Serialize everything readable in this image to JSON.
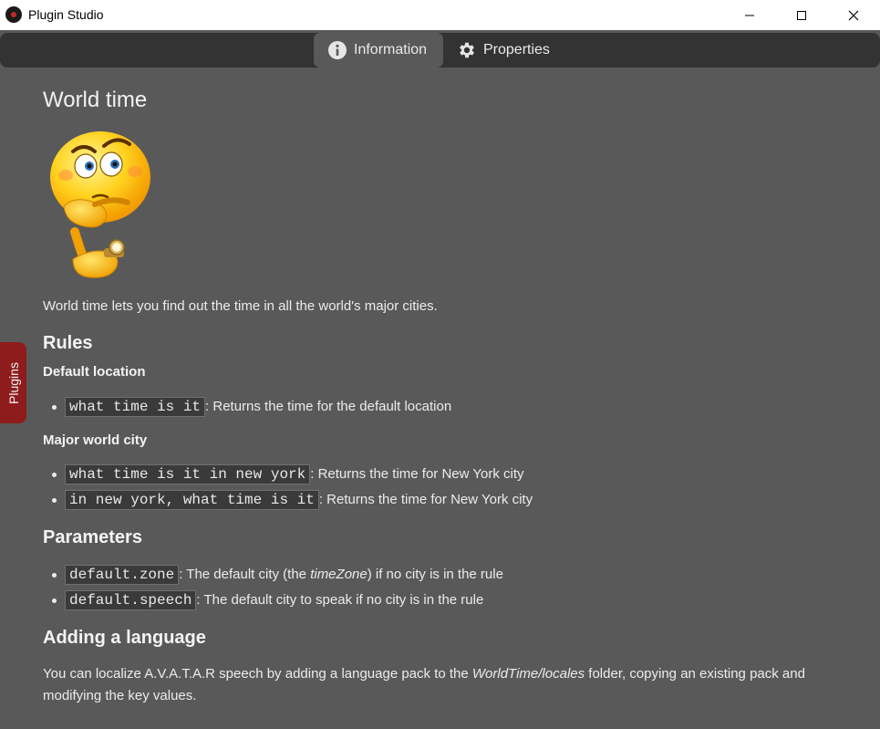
{
  "window": {
    "title": "Plugin Studio"
  },
  "tabs": {
    "information": {
      "label": "Information",
      "icon": "info-icon",
      "active": true
    },
    "properties": {
      "label": "Properties",
      "icon": "gear-icon",
      "active": false
    }
  },
  "side_tab": {
    "label": "Plugins"
  },
  "page": {
    "title": "World time",
    "image": "thinking-emoji-with-watch",
    "intro": "World time lets you find out the time in all the world's major cities.",
    "rules_heading": "Rules",
    "default_location": {
      "heading": "Default location",
      "items": [
        {
          "code": "what time is it",
          "desc": ": Returns the time for the default location"
        }
      ]
    },
    "major_city": {
      "heading": "Major world city",
      "items": [
        {
          "code": "what time is it in new york",
          "desc": ": Returns the time for New York city"
        },
        {
          "code": "in new york, what time is it",
          "desc": ": Returns the time for New York city"
        }
      ]
    },
    "parameters": {
      "heading": "Parameters",
      "items": [
        {
          "code": "default.zone",
          "desc_pre": ": The default city (the ",
          "desc_em": "timeZone",
          "desc_post": ") if no city is in the rule"
        },
        {
          "code": "default.speech",
          "desc_pre": ": The default city to speak if no city is in the rule",
          "desc_em": "",
          "desc_post": ""
        }
      ]
    },
    "language": {
      "heading": "Adding a language",
      "text_pre": "You can localize A.V.A.T.A.R speech by adding a language pack to the ",
      "text_em": "WorldTime/locales",
      "text_post": " folder, copying an existing pack and modifying the key values."
    }
  },
  "colors": {
    "background": "#595959",
    "tabbar": "#333333",
    "active_tab": "#595959",
    "side_tab": "#8e1c1c"
  }
}
